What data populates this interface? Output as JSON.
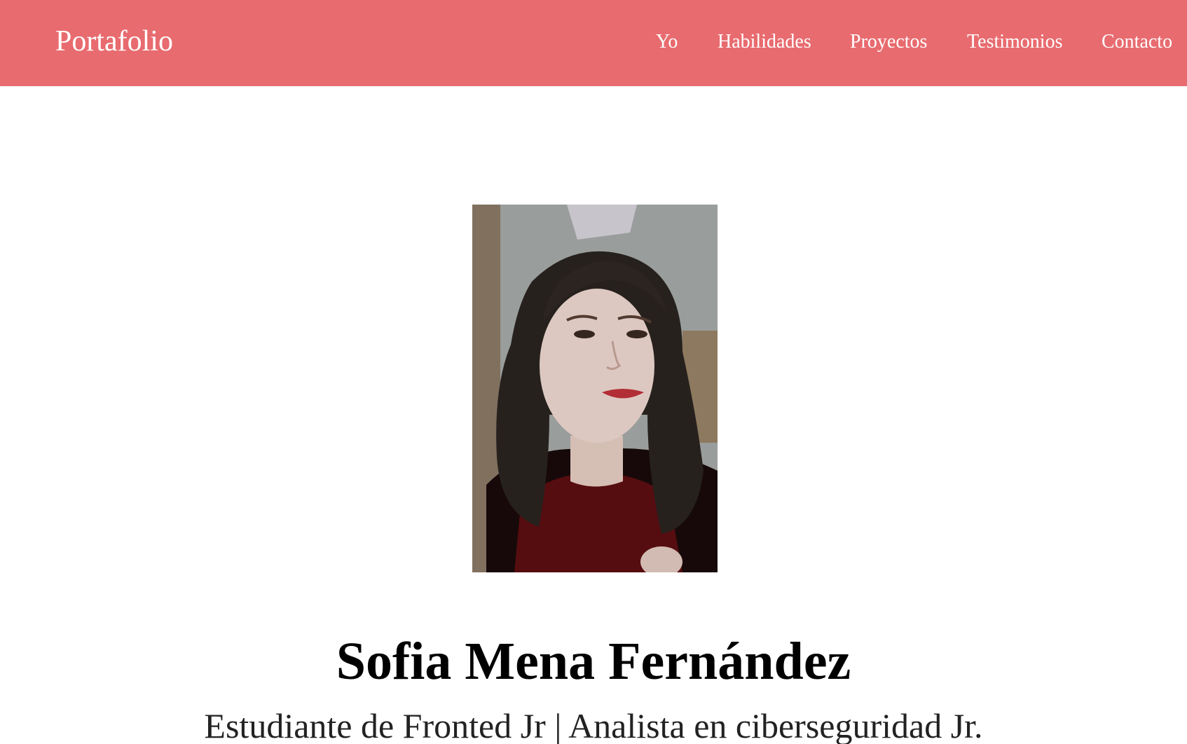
{
  "header": {
    "brand": "Portafolio",
    "nav": [
      {
        "label": "Yo"
      },
      {
        "label": "Habilidades"
      },
      {
        "label": "Proyectos"
      },
      {
        "label": "Testimonios"
      },
      {
        "label": "Contacto"
      }
    ]
  },
  "hero": {
    "photo_icon": "profile-photo",
    "name": "Sofia Mena Fernández",
    "role": "Estudiante de Fronted Jr | Analista en ciberseguridad Jr."
  },
  "colors": {
    "navbar_bg": "#e86b6f",
    "nav_text": "#ffffff",
    "page_bg": "#ffffff",
    "name_text": "#000000"
  }
}
